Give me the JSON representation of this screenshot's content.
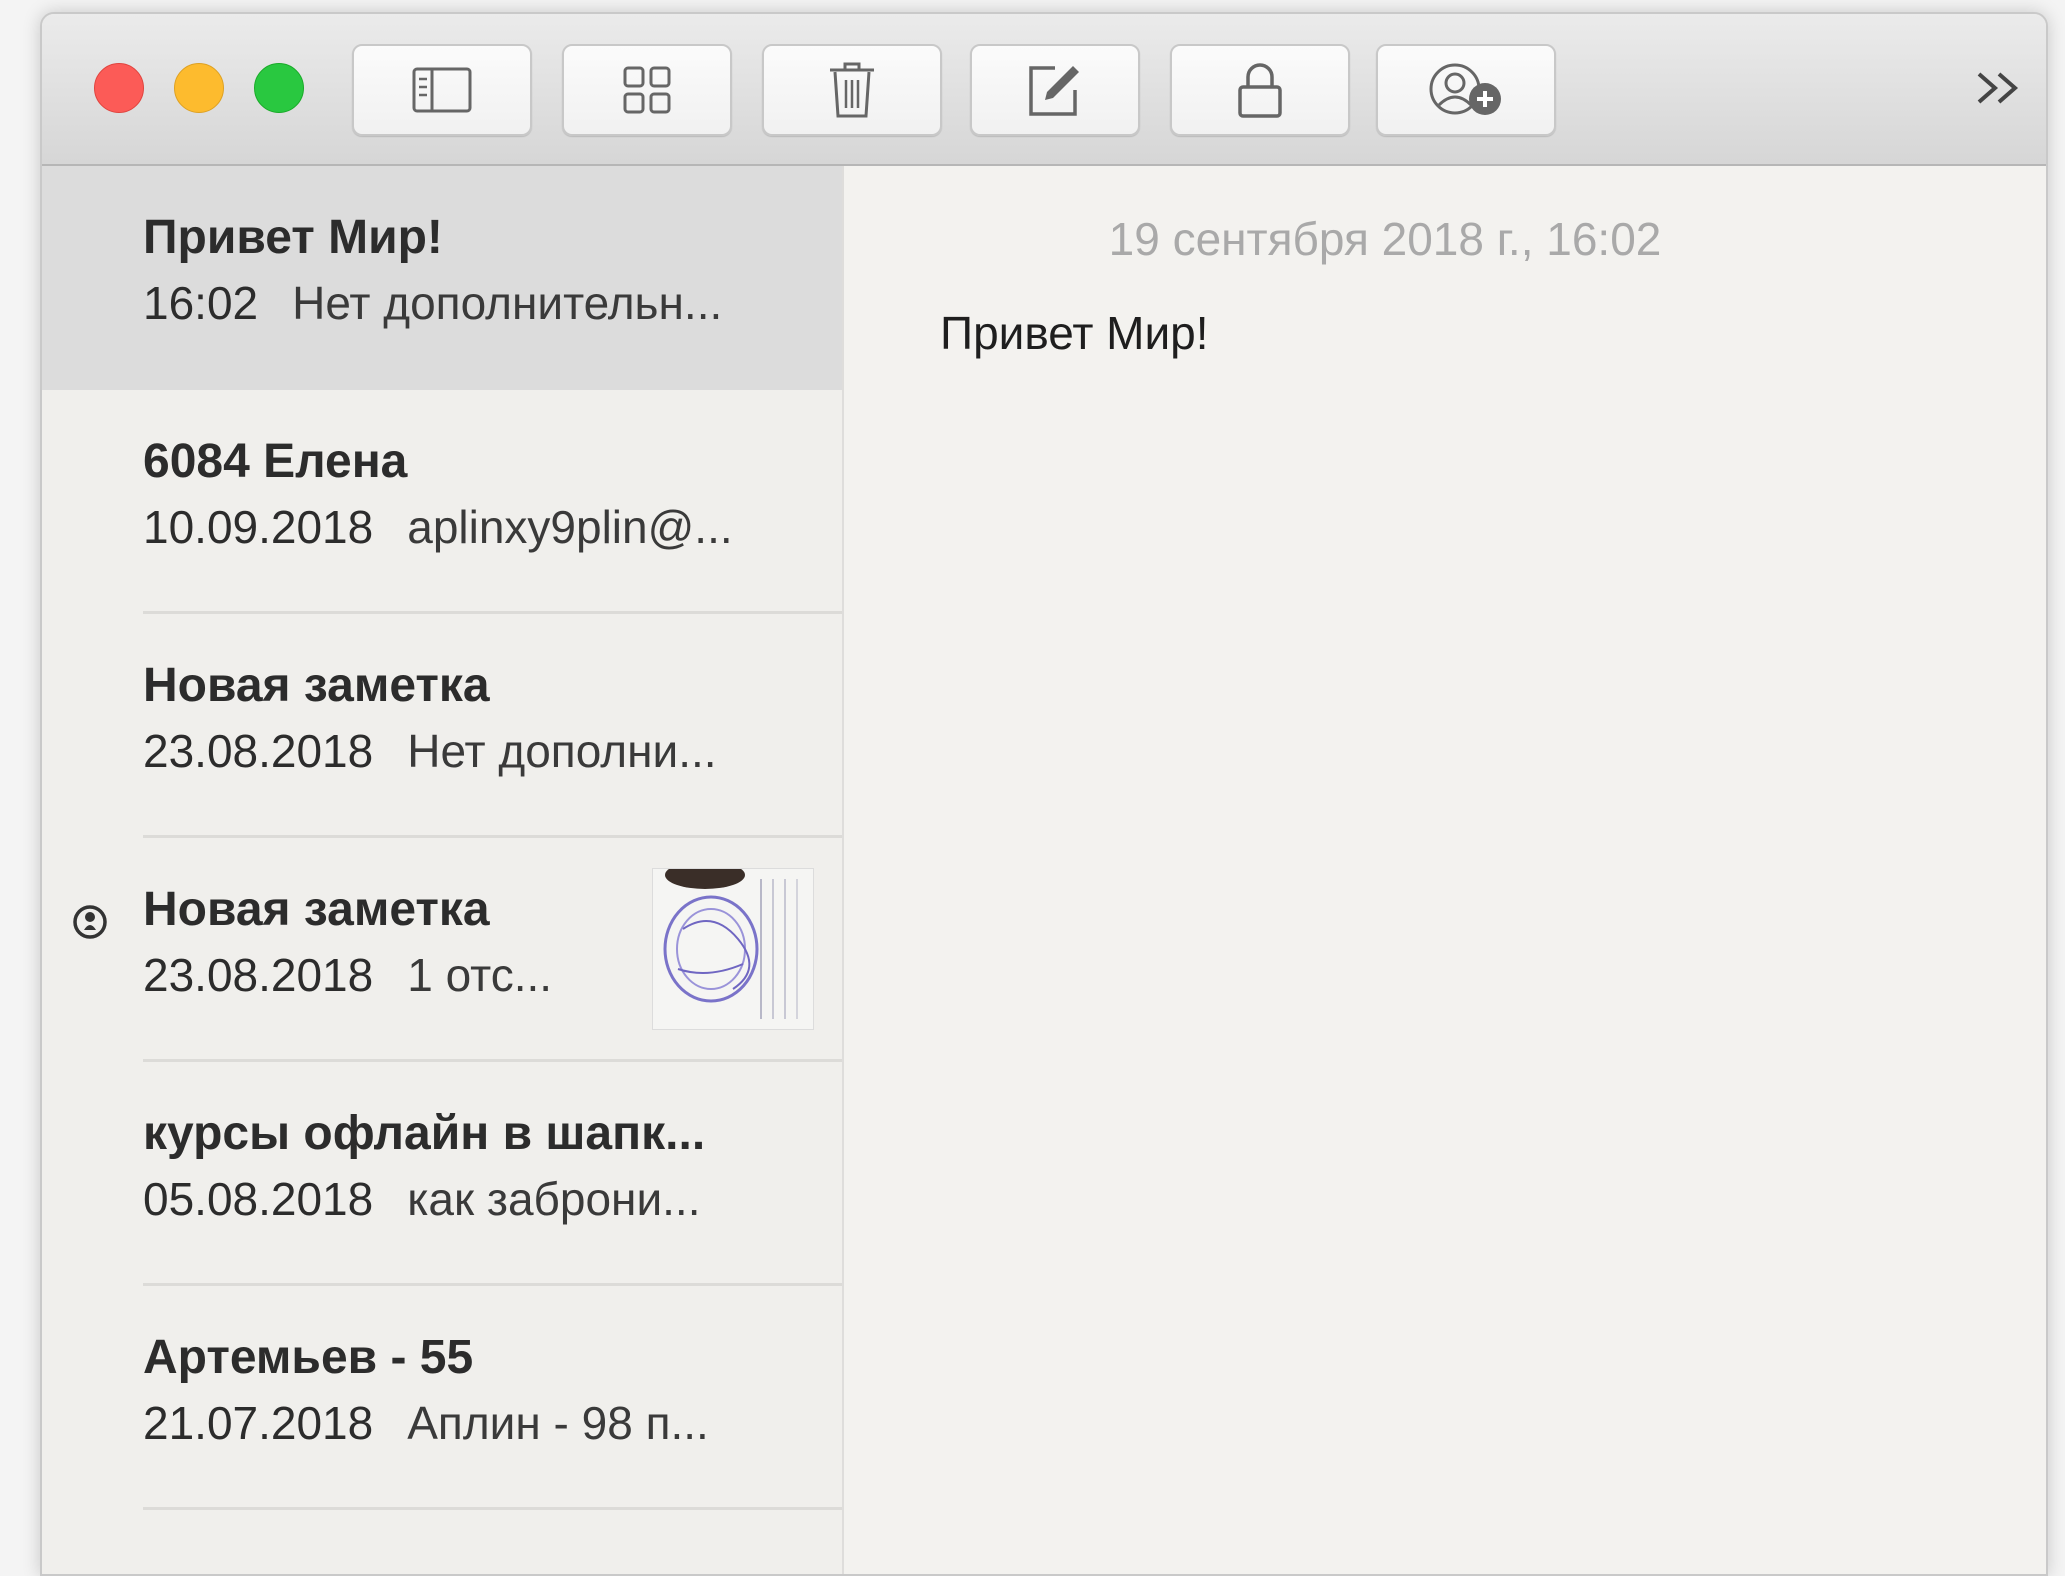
{
  "toolbar": {
    "buttons": [
      {
        "icon": "sidebar-toggle-icon"
      },
      {
        "icon": "grid-view-icon"
      },
      {
        "icon": "trash-icon"
      },
      {
        "icon": "compose-icon"
      },
      {
        "icon": "lock-icon"
      },
      {
        "icon": "add-people-icon"
      }
    ],
    "overflow_label": "»"
  },
  "notes": [
    {
      "title": "Привет Мир!",
      "date": "16:02",
      "preview": "Нет дополнительн...",
      "selected": true
    },
    {
      "title": "6084 Елена",
      "date": "10.09.2018",
      "preview": "aplinxy9plin@..."
    },
    {
      "title": "Новая заметка",
      "date": "23.08.2018",
      "preview": "Нет дополни..."
    },
    {
      "title": "Новая заметка",
      "date": "23.08.2018",
      "preview": "1 отс...",
      "shared": true,
      "has_thumbnail": true
    },
    {
      "title": "курсы офлайн в шапк...",
      "date": "05.08.2018",
      "preview": "как заброни..."
    },
    {
      "title": "Артемьев - 55",
      "date": "21.07.2018",
      "preview": "Аплин - 98 п..."
    }
  ],
  "editor": {
    "timestamp": "19 сентября 2018 г., 16:02",
    "body": "Привет Мир!"
  },
  "colors": {
    "close": "#fc5b57",
    "minimize": "#fdbb2e",
    "zoom": "#29c840",
    "selected_row": "#dcdcdc"
  }
}
